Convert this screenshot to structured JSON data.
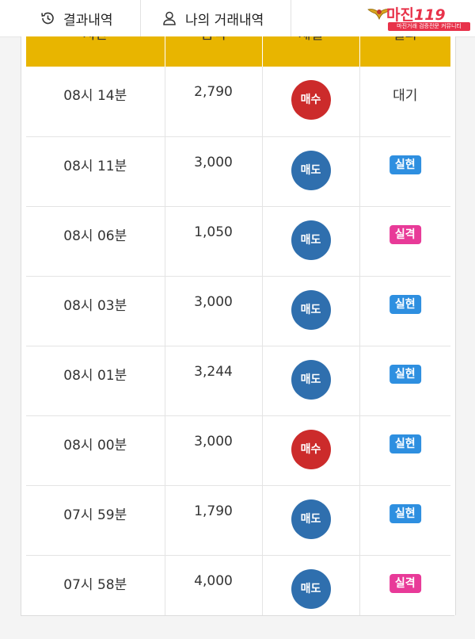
{
  "tabs": {
    "result_label": "결과내역",
    "mine_label": "나의 거래내역"
  },
  "logo": {
    "title": "마진",
    "title_suffix": "119",
    "subtitle": "마진거래 검증전문 커뮤니티"
  },
  "table": {
    "headers": [
      "시간",
      "금액",
      "체결",
      "결과"
    ],
    "rows": [
      {
        "time": "08시 14분",
        "amount": "2,790",
        "side": "매수",
        "side_type": "buy",
        "result": "대기",
        "result_type": "pending"
      },
      {
        "time": "08시 11분",
        "amount": "3,000",
        "side": "매도",
        "side_type": "sell",
        "result": "실현",
        "result_type": "win"
      },
      {
        "time": "08시 06분",
        "amount": "1,050",
        "side": "매도",
        "side_type": "sell",
        "result": "실격",
        "result_type": "lose"
      },
      {
        "time": "08시 03분",
        "amount": "3,000",
        "side": "매도",
        "side_type": "sell",
        "result": "실현",
        "result_type": "win"
      },
      {
        "time": "08시 01분",
        "amount": "3,244",
        "side": "매도",
        "side_type": "sell",
        "result": "실현",
        "result_type": "win"
      },
      {
        "time": "08시 00분",
        "amount": "3,000",
        "side": "매수",
        "side_type": "buy",
        "result": "실현",
        "result_type": "win"
      },
      {
        "time": "07시 59분",
        "amount": "1,790",
        "side": "매도",
        "side_type": "sell",
        "result": "실현",
        "result_type": "win"
      },
      {
        "time": "07시 58분",
        "amount": "4,000",
        "side": "매도",
        "side_type": "sell",
        "result": "실격",
        "result_type": "lose"
      }
    ]
  },
  "colors": {
    "header_bg": "#e8b500",
    "buy": "#cc2b2b",
    "sell": "#2f6fae",
    "win": "#2e8fe0",
    "lose": "#e83a98",
    "logo": "#e8324a"
  },
  "icons": {
    "result_tab": "history-icon",
    "mine_tab": "user-icon",
    "logo_emblem": "eagle-emblem-icon"
  }
}
